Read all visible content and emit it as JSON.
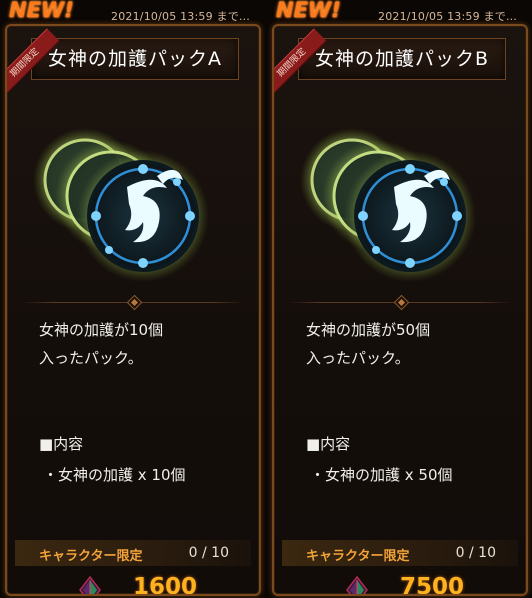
{
  "cards": [
    {
      "badge": "NEW!",
      "timestamp": "2021/10/05 13:59 まで…",
      "ribbon": "期間限定",
      "title": "女神の加護パックA",
      "description_line1": "女神の加護が10個",
      "description_line2": "入ったパック。",
      "contents_heading": "■内容",
      "contents_item": "・女神の加護 x 10個",
      "limit_label": "キャラクター限定",
      "limit_count": "0 / 10",
      "price": "1600",
      "currency_icon": "gem-icon"
    },
    {
      "badge": "NEW!",
      "timestamp": "2021/10/05 13:59 まで…",
      "ribbon": "期間限定",
      "title": "女神の加護パックB",
      "description_line1": "女神の加護が50個",
      "description_line2": "入ったパック。",
      "contents_heading": "■内容",
      "contents_item": "・女神の加護 x 50個",
      "limit_label": "キャラクター限定",
      "limit_count": "0 / 10",
      "price": "7500",
      "currency_icon": "gem-icon"
    }
  ],
  "colors": {
    "accent_orange": "#ff7a1a",
    "price_gold": "#ffb21f",
    "limit_label": "#f2a33a",
    "frame_border": "#7a4a1c",
    "medallion_glow": "#e6ff9a",
    "medallion_ring": "#2f8fd6"
  }
}
